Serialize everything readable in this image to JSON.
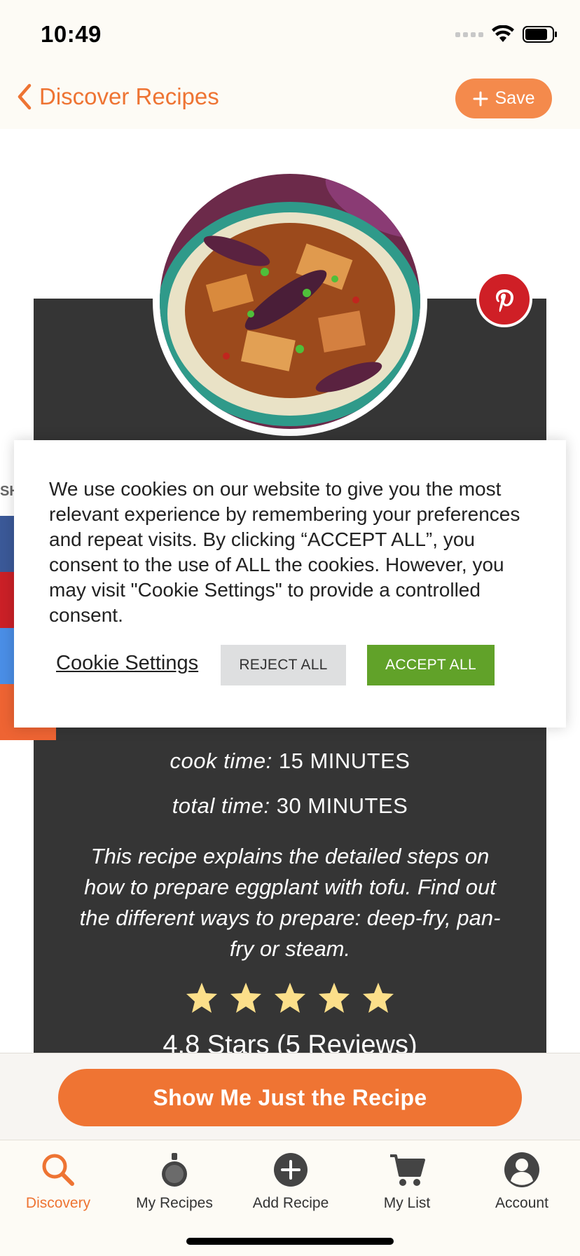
{
  "status_bar": {
    "time": "10:49"
  },
  "header": {
    "back_label": "Discover Recipes",
    "save_label": "Save"
  },
  "share": {
    "label": "SH"
  },
  "recipe": {
    "cook_time_label": "cook time:",
    "cook_time_value": "15 MINUTES",
    "total_time_label": "total time:",
    "total_time_value": "30 MINUTES",
    "description": "This recipe explains the detailed steps on how to prepare eggplant with tofu. Find out the different ways to prepare: deep-fry, pan-fry or steam.",
    "rating_stars": 5,
    "rating_text": "4.8 Stars (5 Reviews)"
  },
  "cookie_dialog": {
    "text": "We use cookies on our website to give you the most relevant experience by remembering your preferences and repeat visits. By clicking “ACCEPT ALL”, you consent to the use of ALL the cookies. However, you may visit \"Cookie Settings\" to provide a controlled consent.",
    "settings_label": "Cookie Settings",
    "reject_label": "REJECT ALL",
    "accept_label": "ACCEPT ALL"
  },
  "cta": {
    "label": "Show Me Just the Recipe"
  },
  "tab_bar": {
    "tabs": [
      {
        "label": "Discovery",
        "icon": "search-icon",
        "active": true
      },
      {
        "label": "My Recipes",
        "icon": "pot-icon",
        "active": false
      },
      {
        "label": "Add Recipe",
        "icon": "plus-circle-icon",
        "active": false
      },
      {
        "label": "My List",
        "icon": "cart-icon",
        "active": false
      },
      {
        "label": "Account",
        "icon": "account-icon",
        "active": false
      }
    ]
  },
  "colors": {
    "accent": "#ee7433",
    "accept": "#61a229",
    "pinterest": "#cf1f26",
    "panel": "#353535"
  }
}
